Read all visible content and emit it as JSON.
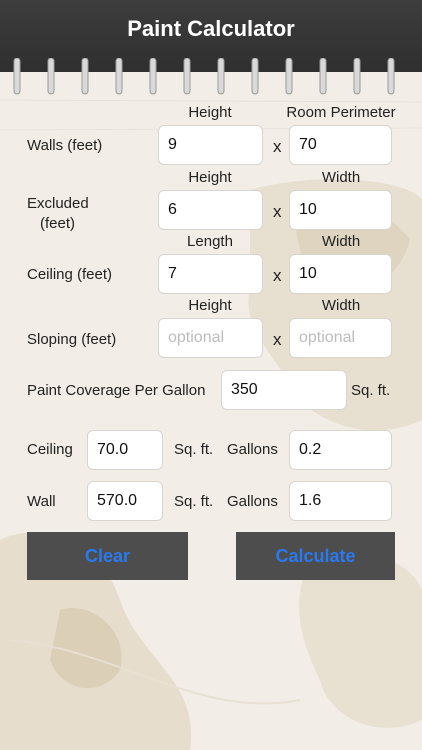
{
  "app": {
    "title": "Paint Calculator"
  },
  "rows": {
    "walls": {
      "label": "Walls (feet)",
      "h1": "Height",
      "h2": "Room Perimeter",
      "v1": "9",
      "v2": "70"
    },
    "excluded": {
      "label1": "Excluded",
      "label2": "(feet)",
      "h1": "Height",
      "h2": "Width",
      "v1": "6",
      "v2": "10"
    },
    "ceiling": {
      "label": "Ceiling (feet)",
      "h1": "Length",
      "h2": "Width",
      "v1": "7",
      "v2": "10"
    },
    "sloping": {
      "label": "Sloping (feet)",
      "h1": "Height",
      "h2": "Width",
      "ph1": "optional",
      "ph2": "optional"
    }
  },
  "coverage": {
    "label": "Paint Coverage Per Gallon",
    "value": "350",
    "unit": "Sq. ft."
  },
  "results": {
    "ceiling": {
      "label": "Ceiling",
      "area": "70.0",
      "unit": "Sq. ft.",
      "gallons_label": "Gallons",
      "gallons": "0.2"
    },
    "wall": {
      "label": "Wall",
      "area": "570.0",
      "unit": "Sq. ft.",
      "gallons_label": "Gallons",
      "gallons": "1.6"
    }
  },
  "buttons": {
    "clear": "Clear",
    "calculate": "Calculate"
  },
  "x_symbol": "x",
  "colors": {
    "header": "#333333",
    "button_bg": "#4d4d4d",
    "button_text": "#2a79ef"
  }
}
